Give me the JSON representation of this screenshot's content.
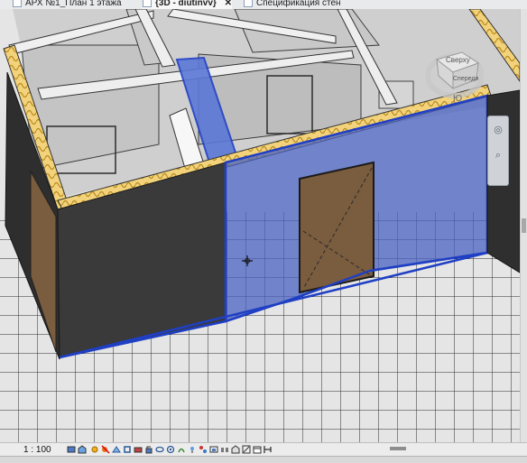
{
  "tabs": [
    {
      "label": "АРХ №1_План 1 этажа",
      "active": false,
      "closable": false,
      "icon": "floor-plan-icon"
    },
    {
      "label": "{3D - diutinvv}",
      "active": true,
      "closable": true,
      "icon": "3d-view-icon"
    },
    {
      "label": "Спецификация стен",
      "active": false,
      "closable": false,
      "icon": "schedule-icon"
    }
  ],
  "tab_close_symbol": "✕",
  "viewcube": {
    "face_top": "Сверху",
    "face_front": "Спереди",
    "compass": "Ю"
  },
  "status": {
    "scale": "1 : 100"
  },
  "colors": {
    "tab_active_bg": "#f7f7f7",
    "selection_blue": "#1f3fc4",
    "selection_fill": "#4a62c0",
    "wall_dark": "#3a3a3a",
    "insulation": "#e8c86a",
    "door_wood": "#7a5c3e"
  }
}
